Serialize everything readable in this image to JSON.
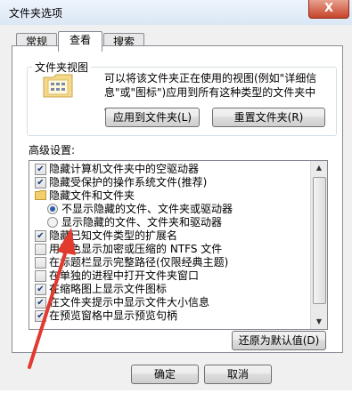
{
  "window": {
    "title": "文件夹选项",
    "close_glyph": "X"
  },
  "tabs": [
    {
      "label": "常规",
      "active": false
    },
    {
      "label": "查看",
      "active": true
    },
    {
      "label": "搜索",
      "active": false
    }
  ],
  "folder_views": {
    "label": "文件夹视图",
    "description_line1": "可以将该文件夹正在使用的视图(例如\"详细信",
    "description_line2": "息\"或\"图标\")应用到所有这种类型的文件夹中",
    "description_line3": "。",
    "apply_button": "应用到文件夹(L)",
    "reset_button": "重置文件夹(R)"
  },
  "advanced": {
    "label": "高级设置:",
    "items": [
      {
        "text": "隐藏计算机文件夹中的空驱动器",
        "kind": "checkbox",
        "checked": true,
        "indent": 0
      },
      {
        "text": "隐藏受保护的操作系统文件(推荐)",
        "kind": "checkbox",
        "checked": true,
        "indent": 0
      },
      {
        "text": "隐藏文件和文件夹",
        "kind": "folder",
        "checked": false,
        "indent": 0
      },
      {
        "text": "不显示隐藏的文件、文件夹或驱动器",
        "kind": "radio",
        "checked": true,
        "indent": 1
      },
      {
        "text": "显示隐藏的文件、文件夹和驱动器",
        "kind": "radio",
        "checked": false,
        "indent": 1
      },
      {
        "text": "隐藏已知文件类型的扩展名",
        "kind": "checkbox",
        "checked": true,
        "indent": 0
      },
      {
        "text": "用彩色显示加密或压缩的 NTFS 文件",
        "kind": "checkbox",
        "checked": false,
        "indent": 0
      },
      {
        "text": "在标题栏显示完整路径(仅限经典主题)",
        "kind": "checkbox",
        "checked": false,
        "indent": 0
      },
      {
        "text": "在单独的进程中打开文件夹窗口",
        "kind": "checkbox",
        "checked": false,
        "indent": 0
      },
      {
        "text": "在缩略图上显示文件图标",
        "kind": "checkbox",
        "checked": true,
        "indent": 0
      },
      {
        "text": "在文件夹提示中显示文件大小信息",
        "kind": "checkbox",
        "checked": true,
        "indent": 0
      },
      {
        "text": "在预览窗格中显示预览句柄",
        "kind": "checkbox",
        "checked": true,
        "indent": 0
      }
    ],
    "restore_button": "还原为默认值(D)"
  },
  "footer": {
    "ok": "确定",
    "cancel": "取消"
  },
  "colors": {
    "annotation_arrow": "#e23a2e",
    "check": "#1b3d7a",
    "radio": "#2b5da8"
  }
}
